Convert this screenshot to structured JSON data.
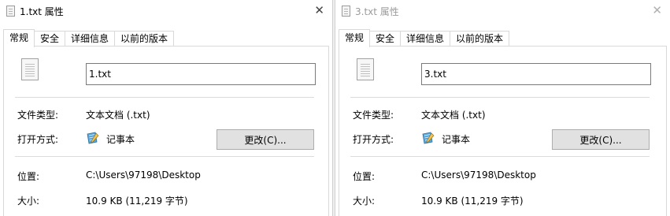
{
  "dialogs": [
    {
      "title": "1.txt 属性",
      "close_glyph": "✕",
      "tabs": [
        "常规",
        "安全",
        "详细信息",
        "以前的版本"
      ],
      "active_tab": "常规",
      "file_name": "1.txt",
      "labels": {
        "type": "文件类型:",
        "open_with": "打开方式:",
        "location": "位置:",
        "size": "大小:"
      },
      "type_value": "文本文档 (.txt)",
      "open_with_app": "记事本",
      "change_button": "更改(C)...",
      "location_value": "C:\\Users\\97198\\Desktop",
      "size_value": "10.9 KB (11,219 字节)"
    },
    {
      "title": "3.txt 属性",
      "close_glyph": "✕",
      "tabs": [
        "常规",
        "安全",
        "详细信息",
        "以前的版本"
      ],
      "active_tab": "常规",
      "file_name": "3.txt",
      "labels": {
        "type": "文件类型:",
        "open_with": "打开方式:",
        "location": "位置:",
        "size": "大小:"
      },
      "type_value": "文本文档 (.txt)",
      "open_with_app": "记事本",
      "change_button": "更改(C)...",
      "location_value": "C:\\Users\\97198\\Desktop",
      "size_value": "10.9 KB (11,219 字节)"
    }
  ],
  "colors": {
    "inactive_title": "#9a9a9a",
    "button_bg": "#e1e1e1",
    "border": "#d9d9d9"
  }
}
